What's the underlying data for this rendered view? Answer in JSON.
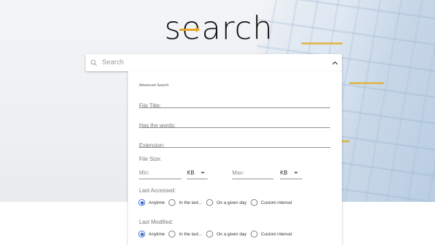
{
  "title": {
    "text": "search"
  },
  "search": {
    "placeholder": "Search"
  },
  "advanced": {
    "heading": "Advanced Search",
    "file_title": "File Title:",
    "has_words": "Has the words:",
    "extension": "Extension:",
    "file_size": {
      "label": "File Size:",
      "min": "Min:",
      "min_unit": "KB",
      "max": "Max:",
      "max_unit": "KB"
    },
    "last_accessed": {
      "label": "Last Accessed:",
      "options": [
        "Anytime",
        "In the last...",
        "On a given day",
        "Custom interval"
      ],
      "selected": "Anytime"
    },
    "last_modified": {
      "label": "Last Modified:",
      "options": [
        "Anytime",
        "In the last...",
        "On a given day",
        "Custom interval"
      ],
      "selected": "Anytime"
    }
  },
  "colors": {
    "accent": "#e3a51f",
    "radio": "#3f6fd1"
  }
}
